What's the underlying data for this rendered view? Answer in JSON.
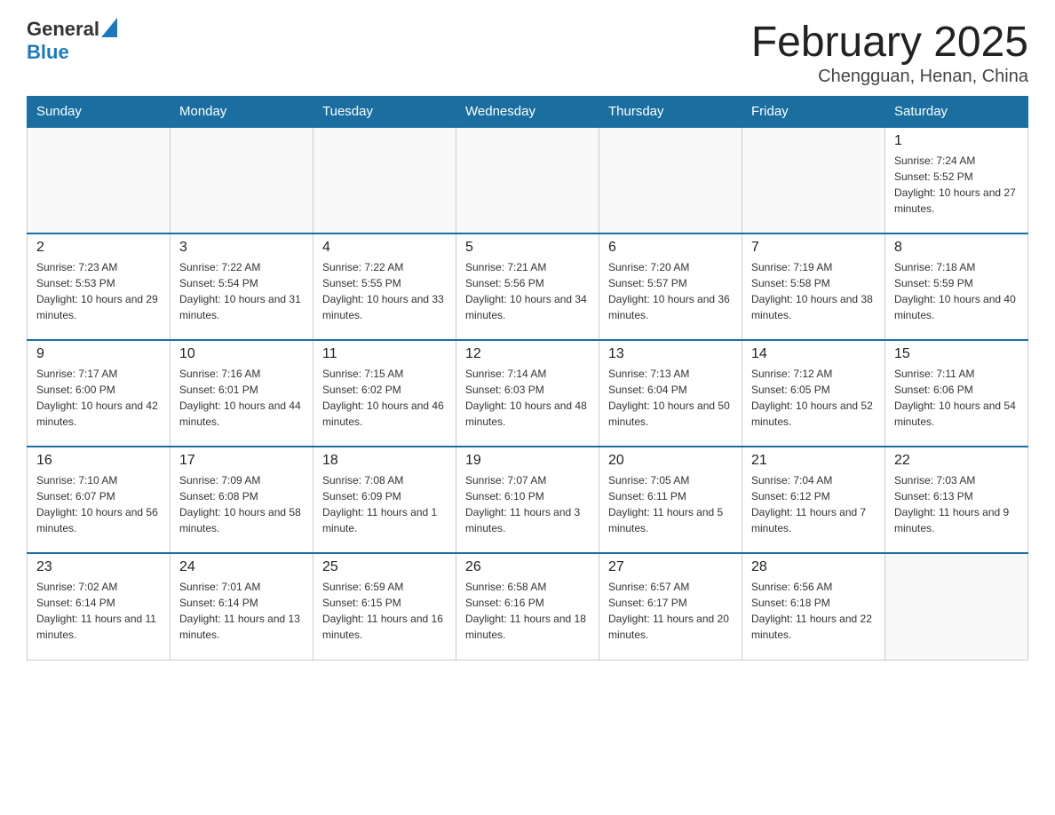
{
  "header": {
    "logo_general": "General",
    "logo_blue": "Blue",
    "month_title": "February 2025",
    "location": "Chengguan, Henan, China"
  },
  "days_of_week": [
    "Sunday",
    "Monday",
    "Tuesday",
    "Wednesday",
    "Thursday",
    "Friday",
    "Saturday"
  ],
  "weeks": [
    [
      {
        "day": "",
        "info": ""
      },
      {
        "day": "",
        "info": ""
      },
      {
        "day": "",
        "info": ""
      },
      {
        "day": "",
        "info": ""
      },
      {
        "day": "",
        "info": ""
      },
      {
        "day": "",
        "info": ""
      },
      {
        "day": "1",
        "info": "Sunrise: 7:24 AM\nSunset: 5:52 PM\nDaylight: 10 hours and 27 minutes."
      }
    ],
    [
      {
        "day": "2",
        "info": "Sunrise: 7:23 AM\nSunset: 5:53 PM\nDaylight: 10 hours and 29 minutes."
      },
      {
        "day": "3",
        "info": "Sunrise: 7:22 AM\nSunset: 5:54 PM\nDaylight: 10 hours and 31 minutes."
      },
      {
        "day": "4",
        "info": "Sunrise: 7:22 AM\nSunset: 5:55 PM\nDaylight: 10 hours and 33 minutes."
      },
      {
        "day": "5",
        "info": "Sunrise: 7:21 AM\nSunset: 5:56 PM\nDaylight: 10 hours and 34 minutes."
      },
      {
        "day": "6",
        "info": "Sunrise: 7:20 AM\nSunset: 5:57 PM\nDaylight: 10 hours and 36 minutes."
      },
      {
        "day": "7",
        "info": "Sunrise: 7:19 AM\nSunset: 5:58 PM\nDaylight: 10 hours and 38 minutes."
      },
      {
        "day": "8",
        "info": "Sunrise: 7:18 AM\nSunset: 5:59 PM\nDaylight: 10 hours and 40 minutes."
      }
    ],
    [
      {
        "day": "9",
        "info": "Sunrise: 7:17 AM\nSunset: 6:00 PM\nDaylight: 10 hours and 42 minutes."
      },
      {
        "day": "10",
        "info": "Sunrise: 7:16 AM\nSunset: 6:01 PM\nDaylight: 10 hours and 44 minutes."
      },
      {
        "day": "11",
        "info": "Sunrise: 7:15 AM\nSunset: 6:02 PM\nDaylight: 10 hours and 46 minutes."
      },
      {
        "day": "12",
        "info": "Sunrise: 7:14 AM\nSunset: 6:03 PM\nDaylight: 10 hours and 48 minutes."
      },
      {
        "day": "13",
        "info": "Sunrise: 7:13 AM\nSunset: 6:04 PM\nDaylight: 10 hours and 50 minutes."
      },
      {
        "day": "14",
        "info": "Sunrise: 7:12 AM\nSunset: 6:05 PM\nDaylight: 10 hours and 52 minutes."
      },
      {
        "day": "15",
        "info": "Sunrise: 7:11 AM\nSunset: 6:06 PM\nDaylight: 10 hours and 54 minutes."
      }
    ],
    [
      {
        "day": "16",
        "info": "Sunrise: 7:10 AM\nSunset: 6:07 PM\nDaylight: 10 hours and 56 minutes."
      },
      {
        "day": "17",
        "info": "Sunrise: 7:09 AM\nSunset: 6:08 PM\nDaylight: 10 hours and 58 minutes."
      },
      {
        "day": "18",
        "info": "Sunrise: 7:08 AM\nSunset: 6:09 PM\nDaylight: 11 hours and 1 minute."
      },
      {
        "day": "19",
        "info": "Sunrise: 7:07 AM\nSunset: 6:10 PM\nDaylight: 11 hours and 3 minutes."
      },
      {
        "day": "20",
        "info": "Sunrise: 7:05 AM\nSunset: 6:11 PM\nDaylight: 11 hours and 5 minutes."
      },
      {
        "day": "21",
        "info": "Sunrise: 7:04 AM\nSunset: 6:12 PM\nDaylight: 11 hours and 7 minutes."
      },
      {
        "day": "22",
        "info": "Sunrise: 7:03 AM\nSunset: 6:13 PM\nDaylight: 11 hours and 9 minutes."
      }
    ],
    [
      {
        "day": "23",
        "info": "Sunrise: 7:02 AM\nSunset: 6:14 PM\nDaylight: 11 hours and 11 minutes."
      },
      {
        "day": "24",
        "info": "Sunrise: 7:01 AM\nSunset: 6:14 PM\nDaylight: 11 hours and 13 minutes."
      },
      {
        "day": "25",
        "info": "Sunrise: 6:59 AM\nSunset: 6:15 PM\nDaylight: 11 hours and 16 minutes."
      },
      {
        "day": "26",
        "info": "Sunrise: 6:58 AM\nSunset: 6:16 PM\nDaylight: 11 hours and 18 minutes."
      },
      {
        "day": "27",
        "info": "Sunrise: 6:57 AM\nSunset: 6:17 PM\nDaylight: 11 hours and 20 minutes."
      },
      {
        "day": "28",
        "info": "Sunrise: 6:56 AM\nSunset: 6:18 PM\nDaylight: 11 hours and 22 minutes."
      },
      {
        "day": "",
        "info": ""
      }
    ]
  ]
}
